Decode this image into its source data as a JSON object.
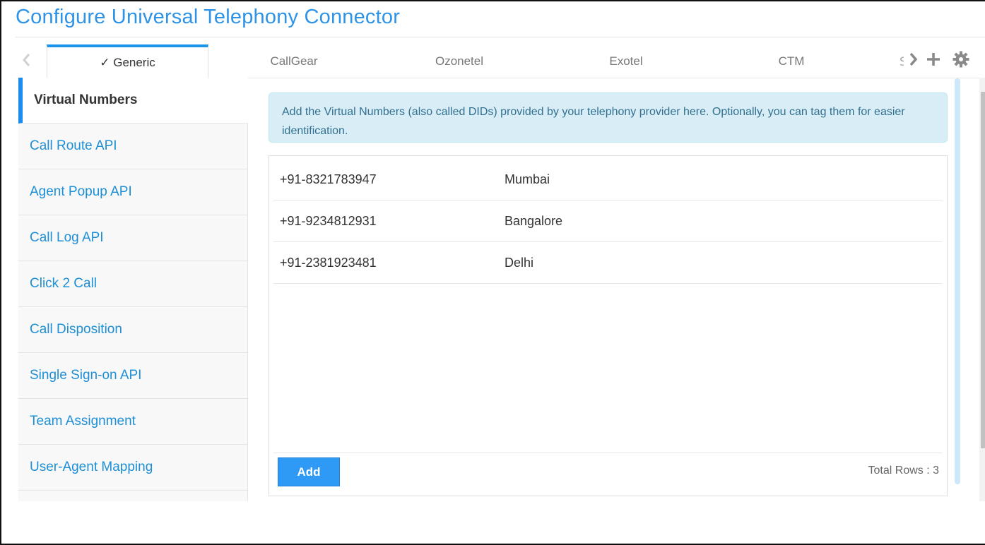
{
  "header": {
    "title": "Configure Universal Telephony Connector"
  },
  "tabs": [
    {
      "label": "✓ Generic",
      "active": true
    },
    {
      "label": "CallGear",
      "active": false
    },
    {
      "label": "Ozonetel",
      "active": false
    },
    {
      "label": "Exotel",
      "active": false
    },
    {
      "label": "CTM",
      "active": false
    },
    {
      "label": "S",
      "active": false
    }
  ],
  "tab_icons": {
    "prev": "chevron-left-icon",
    "next": "chevron-right-icon",
    "add": "plus-icon",
    "settings": "gear-icon"
  },
  "sidebar": {
    "items": [
      {
        "label": "Virtual Numbers",
        "active": true
      },
      {
        "label": "Call Route API"
      },
      {
        "label": "Agent Popup API"
      },
      {
        "label": "Call Log API"
      },
      {
        "label": "Click 2 Call"
      },
      {
        "label": "Call Disposition"
      },
      {
        "label": "Single Sign-on API"
      },
      {
        "label": "Team Assignment"
      },
      {
        "label": "User-Agent Mapping"
      },
      {
        "label": ""
      }
    ]
  },
  "main": {
    "info_text": "Add the Virtual Numbers (also called DIDs) provided by your telephony provider here. Optionally, you can tag them for easier identification.",
    "rows": [
      {
        "number": "+91-8321783947",
        "tag": "Mumbai"
      },
      {
        "number": "+91-9234812931",
        "tag": "Bangalore"
      },
      {
        "number": "+91-2381923481",
        "tag": "Delhi"
      }
    ],
    "add_label": "Add",
    "total_rows": "Total Rows : 3"
  },
  "colors": {
    "accent": "#2e93e6",
    "active_tab_bar": "#1a94e8",
    "info_bg": "#d9edf7",
    "add_button": "#2e9af5"
  }
}
